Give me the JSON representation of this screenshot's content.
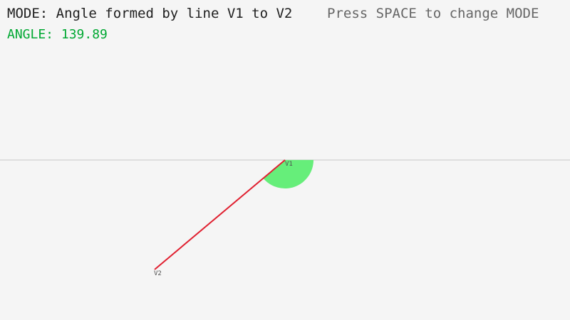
{
  "hud": {
    "mode_text": "MODE: Angle formed by line V1 to V2",
    "hint_text": "Press SPACE to change MODE",
    "angle_text": "ANGLE: 139.89"
  },
  "scene": {
    "angle_degrees": 139.89,
    "v1_label": "V1",
    "v2_label": "V2"
  },
  "colors": {
    "background": "#f5f5f5",
    "mode_text": "#1e1e1e",
    "hint_text": "#666666",
    "angle_text": "#00a832",
    "axis_line": "#c8c8c8",
    "angle_arc": "#66ee7a",
    "vector_line": "#e02030",
    "vertex_label": "#505050"
  }
}
